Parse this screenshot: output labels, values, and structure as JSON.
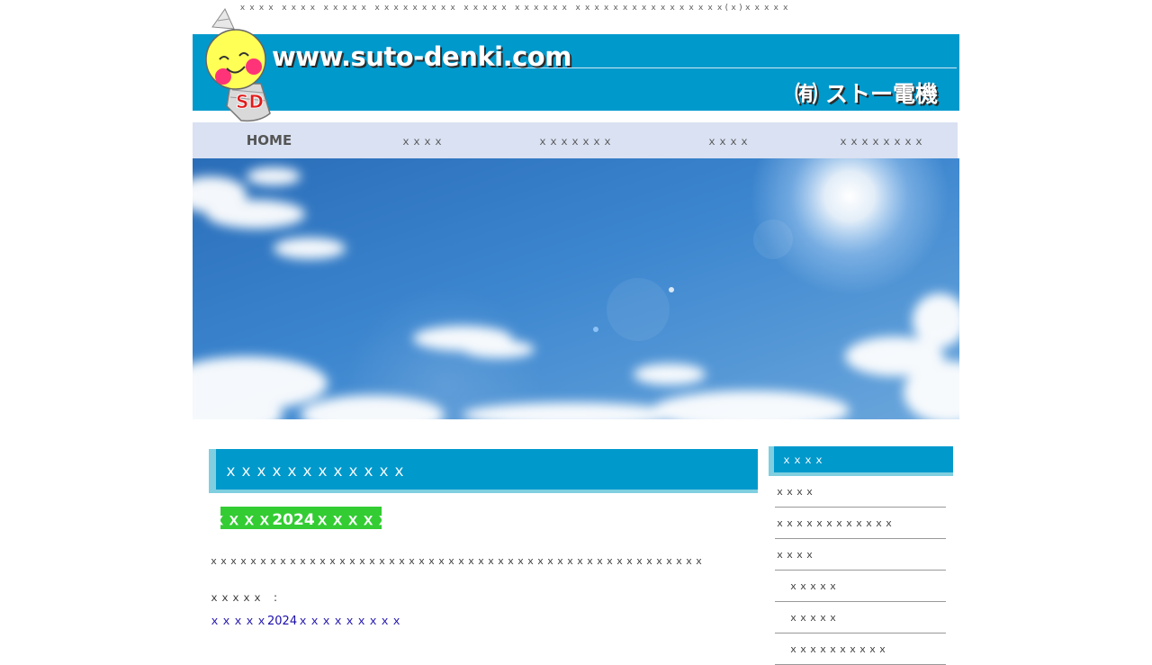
{
  "header": {
    "tagline": "ｘｘｘｘ ｘｘｘｘ ｘｘｘｘｘ ｘｘｘｘｘｘｘｘｘ ｘｘｘｘｘ ｘｘｘｘｘｘ ｘｘｘｘｘｘｘｘｘｘｘｘｘｘｘｘ(ｘ)ｘｘｘｘｘ",
    "site_url": "www.suto-denki.com",
    "company_name": "㈲ ストー電機",
    "mascot_mark": "SD"
  },
  "nav": {
    "items": [
      {
        "label": "HOME"
      },
      {
        "label": "ｘｘｘｘ"
      },
      {
        "label": "ｘｘｘｘｘｘｘ"
      },
      {
        "label": "ｘｘｘｘ"
      },
      {
        "label": "ｘｘｘｘｘｘｘｘ"
      }
    ]
  },
  "main": {
    "section_title": "ｘｘｘｘｘｘｘｘｘｘｘｘ",
    "badge": "ｘｘｘｘｘ2024ｘｘｘｘｘｘ",
    "intro": "ｘｘｘｘｘｘｘｘｘｘｘｘｘｘｘｘｘｘｘｘｘｘｘｘｘｘｘｘｘｘｘｘｘｘｘｘｘｘｘｘｘｘｘｘｘｘｘｘｘｘ",
    "field_label": "ｘｘｘｘｘ　:",
    "field_link": "ｘｘｘｘｘ2024ｘｘｘｘｘｘｘｘｘ"
  },
  "sidebar": {
    "title": "ｘｘｘｘ",
    "items": [
      {
        "label": "ｘｘｘｘ"
      },
      {
        "label": "ｘｘｘｘｘｘｘｘｘｘｘｘ"
      },
      {
        "label": "ｘｘｘｘ"
      },
      {
        "label": "ｘｘｘｘｘ"
      },
      {
        "label": "ｘｘｘｘｘ"
      },
      {
        "label": "ｘｘｘｘｘｘｘｘｘｘ"
      }
    ]
  },
  "colors": {
    "banner": "#0099cc",
    "nav_bg": "#d9e1f2",
    "badge": "#33cc33",
    "link": "#1a0dab"
  }
}
